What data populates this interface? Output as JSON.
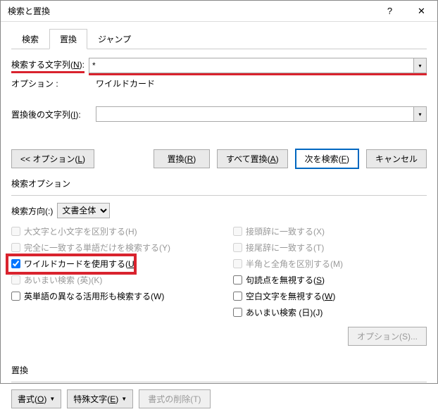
{
  "title": "検索と置換",
  "titlebar": {
    "help": "?",
    "close": "✕"
  },
  "tabs": {
    "find": "検索",
    "replace": "置換",
    "jump": "ジャンプ"
  },
  "findRow": {
    "label_pre": "検索する文字列(",
    "label_m": "N",
    "label_post": "):",
    "value": "*"
  },
  "optionsLine": {
    "label": "オプション :",
    "value": "ワイルドカード"
  },
  "replaceRow": {
    "label_pre": "置換後の文字列(",
    "label_m": "I",
    "label_post": "):",
    "value": ""
  },
  "buttons": {
    "lessOptions_pre": "<< オプション(",
    "lessOptions_m": "L",
    "lessOptions_post": ")",
    "replace_pre": "置換(",
    "replace_m": "R",
    "replace_post": ")",
    "replaceAll_pre": "すべて置換(",
    "replaceAll_m": "A",
    "replaceAll_post": ")",
    "findNext_pre": "次を検索(",
    "findNext_m": "F",
    "findNext_post": ")",
    "cancel": "キャンセル"
  },
  "searchOptionsTitle": "検索オプション",
  "searchDirection": {
    "label": "検索方向(:)",
    "value": "文書全体"
  },
  "leftOptions": {
    "matchCase": "大文字と小文字を区別する(H)",
    "wholeWord": "完全に一致する単語だけを検索する(Y)",
    "wildcard_pre": "ワイルドカードを使用する(",
    "wildcard_m": "U",
    "wildcard_post": ")",
    "fuzzy": "あいまい検索 (英)(K)",
    "wordForms": "英単語の異なる活用形も検索する(W)"
  },
  "rightOptions": {
    "prefix": "接頭辞に一致する(X)",
    "suffix": "接尾辞に一致する(T)",
    "halfFull": "半角と全角を区別する(M)",
    "punct_pre": "句読点を無視する(",
    "punct_m": "S",
    "punct_post": ")",
    "whitespace_pre": "空白文字を無視する(",
    "whitespace_m": "W",
    "whitespace_post": ")",
    "fuzzyJP": "あいまい検索 (日)(J)",
    "fuzzyOptions": "オプション(S)..."
  },
  "replaceSection": {
    "title": "置換",
    "format_pre": "書式(",
    "format_m": "O",
    "format_post": ")",
    "special_pre": "特殊文字(",
    "special_m": "E",
    "special_post": ")",
    "removeFmt": "書式の削除(T)"
  }
}
